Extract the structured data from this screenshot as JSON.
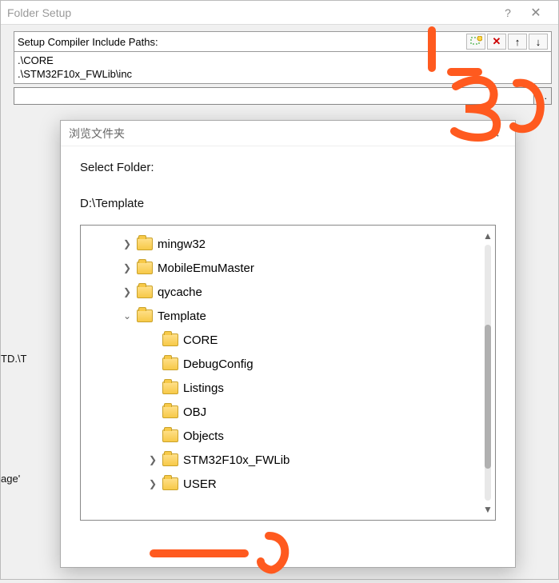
{
  "folder_setup": {
    "title": "Folder Setup",
    "label": "Setup Compiler Include Paths:",
    "paths": ".\\CORE\n.\\STM32F10x_FWLib\\inc",
    "input_value": "",
    "browse_btn": "...",
    "toolbar": {
      "new": "new-icon",
      "delete": "✕",
      "up": "↑",
      "down": "↓"
    },
    "left_frag_age": "age'",
    "left_frag_td": "TD.\\T"
  },
  "browse": {
    "title": "浏览文件夹",
    "prompt": "Select Folder:",
    "path": "D:\\Template",
    "tree": [
      {
        "depth": 1,
        "exp": ">",
        "name": "mingw32"
      },
      {
        "depth": 1,
        "exp": ">",
        "name": "MobileEmuMaster"
      },
      {
        "depth": 1,
        "exp": ">",
        "name": "qycache"
      },
      {
        "depth": 1,
        "exp": "v",
        "name": "Template"
      },
      {
        "depth": 2,
        "exp": "",
        "name": "CORE"
      },
      {
        "depth": 2,
        "exp": "",
        "name": "DebugConfig"
      },
      {
        "depth": 2,
        "exp": "",
        "name": "Listings"
      },
      {
        "depth": 2,
        "exp": "",
        "name": "OBJ"
      },
      {
        "depth": 2,
        "exp": "",
        "name": "Objects"
      },
      {
        "depth": 2,
        "exp": ">",
        "name": "STM32F10x_FWLib"
      },
      {
        "depth": 2,
        "exp": ">",
        "name": "USER"
      }
    ]
  },
  "annotations": {
    "label_1": "1",
    "label_2": "2"
  }
}
